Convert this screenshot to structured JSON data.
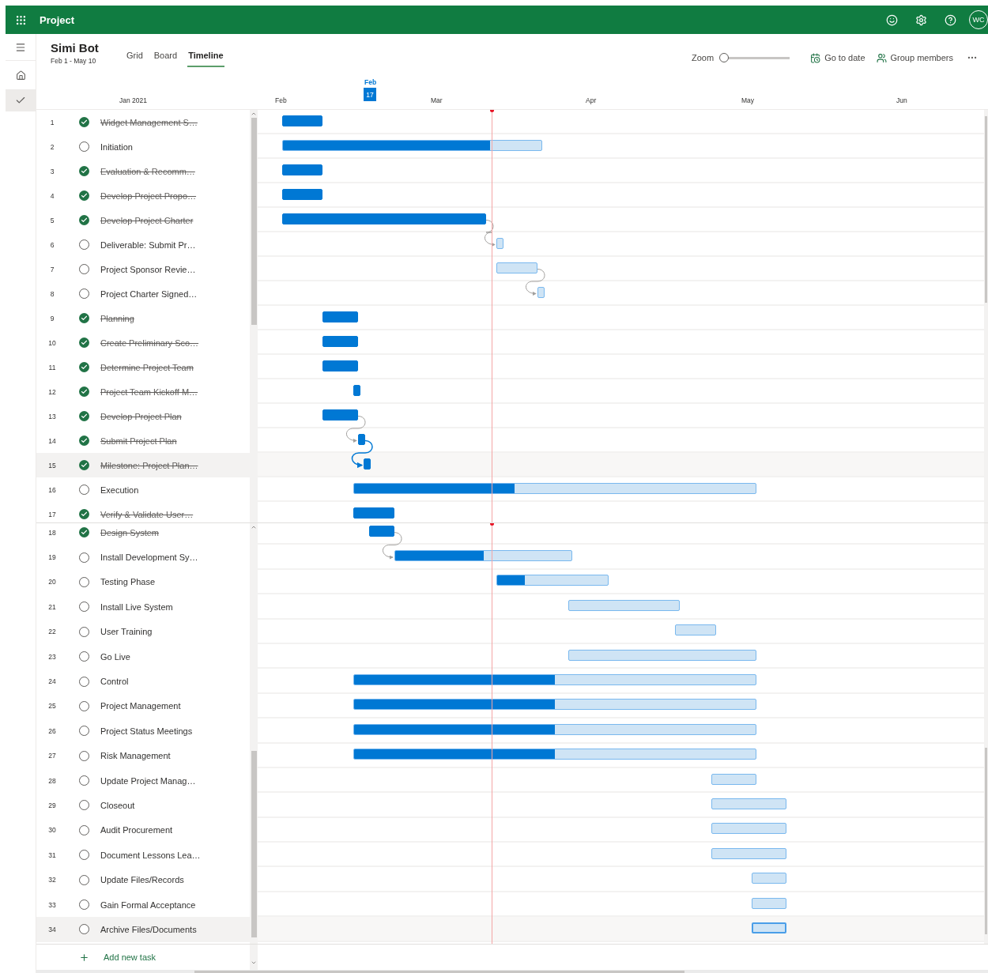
{
  "app": {
    "name": "Project",
    "avatar": "WC"
  },
  "rail": [
    {
      "kind": "menu",
      "selected": false
    },
    {
      "kind": "home",
      "selected": false
    },
    {
      "kind": "tasks",
      "selected": true
    }
  ],
  "plan": {
    "title": "Simi Bot",
    "dates": "Feb 1 - May 10"
  },
  "tabs": [
    {
      "label": "Grid",
      "selected": false
    },
    {
      "label": "Board",
      "selected": false
    },
    {
      "label": "Timeline",
      "selected": true
    }
  ],
  "toolbar": {
    "zoom_label": "Zoom",
    "zoom": {
      "level": 0
    },
    "go_to_date": "Go to date",
    "group_members": "Group members"
  },
  "timeline_header": {
    "months": [
      "Jan 2021",
      "Feb",
      "Mar",
      "Apr",
      "May",
      "Jun"
    ],
    "today": {
      "month": "Feb",
      "day": "17"
    }
  },
  "tasks": [
    {
      "number": "1",
      "name": "Widget Management S…",
      "completed": true,
      "selected": false
    },
    {
      "number": "2",
      "name": "Initiation",
      "completed": false,
      "selected": false,
      "level": 0.8
    },
    {
      "number": "3",
      "name": "Evaluation & Recomm…",
      "completed": true,
      "selected": false
    },
    {
      "number": "4",
      "name": "Develop Project Propo…",
      "completed": true,
      "selected": false
    },
    {
      "number": "5",
      "name": "Develop Project Charter",
      "completed": true,
      "selected": false
    },
    {
      "number": "6",
      "name": "Deliverable: Submit Pr…",
      "completed": false,
      "selected": false
    },
    {
      "number": "7",
      "name": "Project Sponsor Revie…",
      "completed": false,
      "selected": false
    },
    {
      "number": "8",
      "name": "Project Charter Signed…",
      "completed": false,
      "selected": false
    },
    {
      "number": "9",
      "name": "Planning",
      "completed": true,
      "selected": false
    },
    {
      "number": "10",
      "name": "Create Preliminary Sco…",
      "completed": true,
      "selected": false
    },
    {
      "number": "11",
      "name": "Determine Project Team",
      "completed": true,
      "selected": false
    },
    {
      "number": "12",
      "name": "Project Team Kickoff M…",
      "completed": true,
      "selected": false
    },
    {
      "number": "13",
      "name": "Develop Project Plan",
      "completed": true,
      "selected": false
    },
    {
      "number": "14",
      "name": "Submit Project Plan",
      "completed": true,
      "selected": false
    },
    {
      "number": "15",
      "name": "Milestone: Project Plan…",
      "completed": true,
      "selected": true
    },
    {
      "number": "16",
      "name": "Execution",
      "completed": false,
      "selected": false,
      "level": 0.4
    },
    {
      "number": "17",
      "name": "Verify & Validate User…",
      "completed": true,
      "selected": false
    },
    {
      "number": "18",
      "name": "Design System",
      "completed": true,
      "selected": false
    },
    {
      "number": "19",
      "name": "Install Development Sy…",
      "completed": false,
      "selected": false,
      "level": 0.5
    },
    {
      "number": "20",
      "name": "Testing Phase",
      "completed": false,
      "selected": false,
      "level": 0.25
    },
    {
      "number": "21",
      "name": "Install Live System",
      "completed": false,
      "selected": false
    },
    {
      "number": "22",
      "name": "User Training",
      "completed": false,
      "selected": false
    },
    {
      "number": "23",
      "name": "Go Live",
      "completed": false,
      "selected": false
    },
    {
      "number": "24",
      "name": "Control",
      "completed": false,
      "selected": false,
      "level": 0.5
    },
    {
      "number": "25",
      "name": "Project Management",
      "completed": false,
      "selected": false,
      "level": 0.5
    },
    {
      "number": "26",
      "name": "Project Status Meetings",
      "completed": false,
      "selected": false,
      "level": 0.5
    },
    {
      "number": "27",
      "name": "Risk Management",
      "completed": false,
      "selected": false,
      "level": 0.5
    },
    {
      "number": "28",
      "name": "Update Project Manag…",
      "completed": false,
      "selected": false
    },
    {
      "number": "29",
      "name": "Closeout",
      "completed": false,
      "selected": false
    },
    {
      "number": "30",
      "name": "Audit Procurement",
      "completed": false,
      "selected": false
    },
    {
      "number": "31",
      "name": "Document Lessons Lea…",
      "completed": false,
      "selected": false
    },
    {
      "number": "32",
      "name": "Update Files/Records",
      "completed": false,
      "selected": false
    },
    {
      "number": "33",
      "name": "Gain Formal Acceptance",
      "completed": false,
      "selected": false
    },
    {
      "number": "34",
      "name": "Archive Files/Documents",
      "completed": false,
      "selected": true
    }
  ],
  "add_task": "Add new task"
}
